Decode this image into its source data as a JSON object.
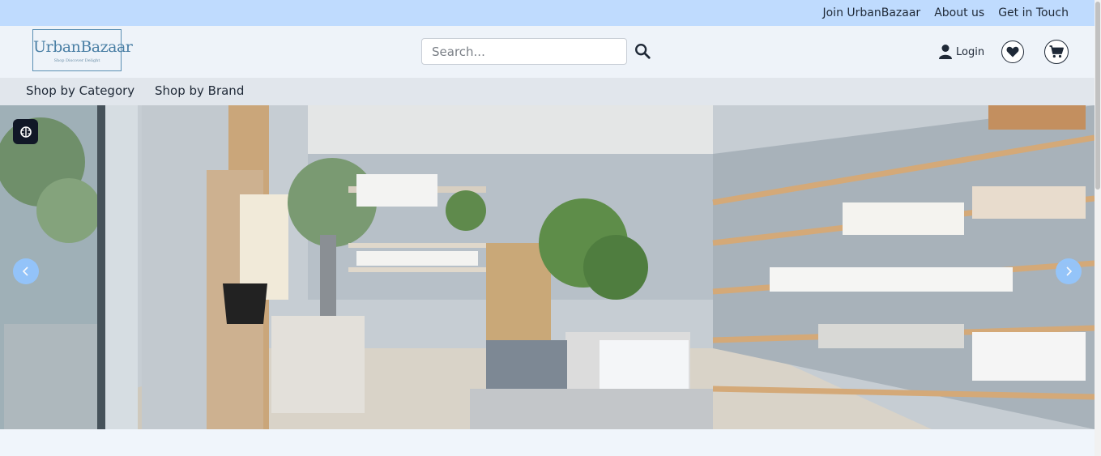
{
  "topbar": {
    "links": [
      "Join UrbanBazaar",
      "About us",
      "Get in Touch"
    ]
  },
  "header": {
    "logo_name": "UrbanBazaar",
    "logo_tagline": "Shop Discover Delight",
    "search_placeholder": "Search...",
    "login_label": "Login",
    "icons": [
      "search-icon",
      "user-icon",
      "heart-icon",
      "cart-icon"
    ]
  },
  "nav": {
    "items": [
      "Shop by Category",
      "Shop by Brand"
    ]
  },
  "hero": {
    "icons": [
      "ai-brain-icon",
      "chevron-left-icon",
      "chevron-right-icon"
    ],
    "accent": "#93c5fd"
  },
  "colors": {
    "topbar": "#bfdbfe",
    "header": "#eef3f9",
    "nav": "#e1e6ec",
    "logo": "#4a7fa5"
  }
}
